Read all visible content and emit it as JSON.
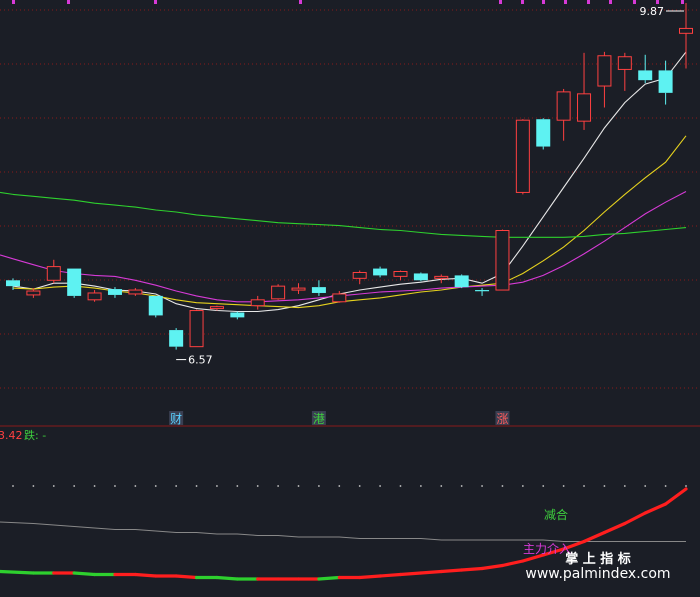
{
  "chart_data": {
    "type": "candlestick",
    "price_panel": {
      "ylim": [
        5.9,
        10.1
      ],
      "annotations": {
        "high_label": "9.87",
        "low_label": "6.57"
      },
      "event_tags": [
        {
          "label": "财",
          "index": 8,
          "color": "#5ad0ff"
        },
        {
          "label": "港",
          "index": 15,
          "color": "#3ecf3e"
        },
        {
          "label": "涨",
          "index": 24,
          "color": "#ff5b5b"
        }
      ],
      "candles": [
        {
          "o": 7.28,
          "h": 7.3,
          "l": 7.18,
          "c": 7.22
        },
        {
          "o": 7.13,
          "h": 7.2,
          "l": 7.1,
          "c": 7.17
        },
        {
          "o": 7.28,
          "h": 7.49,
          "l": 7.25,
          "c": 7.42
        },
        {
          "o": 7.4,
          "h": 7.4,
          "l": 7.1,
          "c": 7.12
        },
        {
          "o": 7.08,
          "h": 7.18,
          "l": 7.06,
          "c": 7.15
        },
        {
          "o": 7.19,
          "h": 7.21,
          "l": 7.1,
          "c": 7.13
        },
        {
          "o": 7.14,
          "h": 7.2,
          "l": 7.12,
          "c": 7.18
        },
        {
          "o": 7.12,
          "h": 7.12,
          "l": 6.9,
          "c": 6.92
        },
        {
          "o": 6.77,
          "h": 6.79,
          "l": 6.57,
          "c": 6.6
        },
        {
          "o": 6.6,
          "h": 6.98,
          "l": 6.6,
          "c": 6.97
        },
        {
          "o": 6.99,
          "h": 7.02,
          "l": 6.97,
          "c": 7.01
        },
        {
          "o": 6.95,
          "h": 6.96,
          "l": 6.88,
          "c": 6.9
        },
        {
          "o": 7.02,
          "h": 7.12,
          "l": 6.98,
          "c": 7.08
        },
        {
          "o": 7.09,
          "h": 7.24,
          "l": 7.08,
          "c": 7.22
        },
        {
          "o": 7.18,
          "h": 7.25,
          "l": 7.14,
          "c": 7.2
        },
        {
          "o": 7.21,
          "h": 7.28,
          "l": 7.12,
          "c": 7.15
        },
        {
          "o": 7.06,
          "h": 7.17,
          "l": 7.05,
          "c": 7.14
        },
        {
          "o": 7.3,
          "h": 7.38,
          "l": 7.24,
          "c": 7.36
        },
        {
          "o": 7.4,
          "h": 7.42,
          "l": 7.31,
          "c": 7.33
        },
        {
          "o": 7.32,
          "h": 7.38,
          "l": 7.28,
          "c": 7.37
        },
        {
          "o": 7.35,
          "h": 7.36,
          "l": 7.27,
          "c": 7.28
        },
        {
          "o": 7.3,
          "h": 7.34,
          "l": 7.25,
          "c": 7.32
        },
        {
          "o": 7.33,
          "h": 7.34,
          "l": 7.2,
          "c": 7.21
        },
        {
          "o": 7.18,
          "h": 7.2,
          "l": 7.12,
          "c": 7.17
        },
        {
          "o": 7.18,
          "h": 7.8,
          "l": 7.18,
          "c": 7.79
        },
        {
          "o": 8.18,
          "h": 8.93,
          "l": 8.16,
          "c": 8.92
        },
        {
          "o": 8.93,
          "h": 8.94,
          "l": 8.62,
          "c": 8.65
        },
        {
          "o": 8.92,
          "h": 9.24,
          "l": 8.71,
          "c": 9.21
        },
        {
          "o": 8.91,
          "h": 9.61,
          "l": 8.82,
          "c": 9.19
        },
        {
          "o": 9.27,
          "h": 9.62,
          "l": 9.05,
          "c": 9.58
        },
        {
          "o": 9.44,
          "h": 9.61,
          "l": 9.22,
          "c": 9.57
        },
        {
          "o": 9.43,
          "h": 9.59,
          "l": 9.3,
          "c": 9.33
        },
        {
          "o": 9.43,
          "h": 9.53,
          "l": 9.08,
          "c": 9.2
        },
        {
          "o": 9.81,
          "h": 10.12,
          "l": 9.45,
          "c": 9.86
        }
      ],
      "ma_lines": [
        {
          "color": "#e8e8e8",
          "values": [
            7.22,
            7.19,
            7.25,
            7.25,
            7.22,
            7.18,
            7.17,
            7.14,
            7.04,
            6.99,
            6.97,
            6.96,
            6.96,
            6.98,
            7.02,
            7.08,
            7.14,
            7.18,
            7.21,
            7.24,
            7.26,
            7.29,
            7.3,
            7.25,
            7.35,
            7.63,
            7.93,
            8.23,
            8.53,
            8.84,
            9.1,
            9.29,
            9.35,
            9.62
          ]
        },
        {
          "color": "#e6d21e",
          "values": [
            7.2,
            7.19,
            7.21,
            7.22,
            7.2,
            7.17,
            7.15,
            7.12,
            7.08,
            7.05,
            7.04,
            7.03,
            7.02,
            7.01,
            7.0,
            7.02,
            7.06,
            7.08,
            7.1,
            7.13,
            7.16,
            7.18,
            7.21,
            7.23,
            7.25,
            7.35,
            7.48,
            7.62,
            7.79,
            7.98,
            8.16,
            8.33,
            8.49,
            8.76
          ]
        },
        {
          "color": "#d63ad6",
          "values": [
            7.5,
            7.44,
            7.38,
            7.35,
            7.33,
            7.32,
            7.28,
            7.23,
            7.17,
            7.12,
            7.08,
            7.06,
            7.06,
            7.07,
            7.08,
            7.1,
            7.12,
            7.14,
            7.16,
            7.17,
            7.18,
            7.2,
            7.21,
            7.22,
            7.23,
            7.26,
            7.33,
            7.43,
            7.55,
            7.68,
            7.82,
            7.96,
            8.08,
            8.19
          ]
        },
        {
          "color": "#2ed02e",
          "values": [
            8.16,
            8.14,
            8.12,
            8.1,
            8.07,
            8.05,
            8.03,
            8.0,
            7.98,
            7.95,
            7.93,
            7.91,
            7.89,
            7.87,
            7.86,
            7.85,
            7.84,
            7.82,
            7.8,
            7.79,
            7.77,
            7.75,
            7.74,
            7.73,
            7.72,
            7.72,
            7.72,
            7.72,
            7.73,
            7.75,
            7.76,
            7.78,
            7.8,
            7.82
          ]
        }
      ]
    },
    "indicator_panel": {
      "ylim": [
        0,
        100
      ],
      "header_value": "3.42",
      "header_series": "跌: -",
      "labels": [
        {
          "text": "减合",
          "color": "#3ecf3e"
        },
        {
          "text": "主力介入",
          "color": "#d63ad6"
        }
      ],
      "series": [
        {
          "color": "#888888",
          "values": [
            40,
            39,
            38,
            37,
            36,
            35,
            35,
            34,
            33,
            33,
            32,
            32,
            31,
            31,
            30,
            30,
            30,
            29,
            29,
            29,
            29,
            28,
            28,
            28,
            28,
            28,
            28,
            27,
            27,
            27,
            27,
            27,
            27,
            27
          ]
        },
        {
          "color": "#c8c8c8",
          "dotted": true,
          "values": [
            64,
            64,
            64,
            64,
            64,
            64,
            64,
            64,
            64,
            64,
            64,
            64,
            64,
            64,
            64,
            64,
            64,
            64,
            64,
            64,
            64,
            64,
            64,
            64,
            64,
            64,
            64,
            64,
            64,
            64,
            64,
            64,
            64,
            64
          ]
        },
        {
          "colors": [
            "#2ed02e",
            "#2ed02e",
            "#ff1e1e",
            "#2ed02e",
            "#2ed02e",
            "#ff1e1e",
            "#ff1e1e",
            "#ff1e1e",
            "#ff1e1e",
            "#2ed02e",
            "#2ed02e",
            "#2ed02e",
            "#ff1e1e",
            "#ff1e1e",
            "#ff1e1e",
            "#2ed02e",
            "#ff1e1e",
            "#ff1e1e",
            "#ff1e1e",
            "#ff1e1e",
            "#ff1e1e",
            "#ff1e1e",
            "#ff1e1e",
            "#ff1e1e",
            "#ff1e1e",
            "#ff1e1e",
            "#ff1e1e",
            "#ff1e1e",
            "#ff1e1e",
            "#ff1e1e",
            "#ff1e1e",
            "#ff1e1e",
            "#ff1e1e",
            "#ff1e1e"
          ],
          "values": [
            7,
            6,
            6,
            6,
            5,
            5,
            5,
            4,
            4,
            3,
            3,
            2,
            2,
            2,
            2,
            2,
            3,
            3,
            4,
            5,
            6,
            7,
            8,
            9,
            11,
            14,
            18,
            22,
            27,
            33,
            39,
            46,
            52,
            62
          ]
        }
      ]
    }
  },
  "watermark": {
    "cn": "掌 上 指 标",
    "url": "www.palmindex.com"
  },
  "colors": {
    "background": "#1b1e26",
    "up": "#ff4040",
    "down": "#5ef2f2",
    "grid": "#8a1a1a"
  }
}
